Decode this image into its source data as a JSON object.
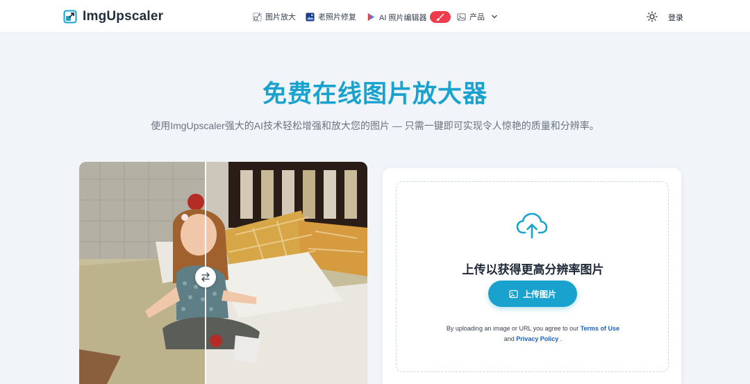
{
  "nav": {
    "brand": "ImgUpscaler",
    "items": [
      {
        "label": "图片放大",
        "icon": "upscale-icon"
      },
      {
        "label": "老照片修复",
        "icon": "photo-restore-icon"
      },
      {
        "label": "AI 照片编辑器",
        "icon": "ai-editor-icon"
      },
      {
        "label": "产品",
        "icon": "image-icon"
      }
    ],
    "login": "登录",
    "theme_icon": "sun-icon",
    "hot_badge_icon": "brush-icon"
  },
  "hero": {
    "title": "免费在线图片放大器",
    "subtitle": "使用ImgUpscaler强大的AI技术轻松增强和放大您的图片 — 只需一键即可实现令人惊艳的质量和分辨率。"
  },
  "compare": {
    "swap_icon": "swap-arrows-icon"
  },
  "upload": {
    "title": "上传以获得更高分辨率图片",
    "button": "上传图片",
    "terms_prefix": "By uploading an image or URL you agree to our",
    "terms_link": "Terms of Use",
    "and": "and",
    "privacy_link": "Privacy Policy",
    "period": "."
  },
  "colors": {
    "accent": "#1aa2cf",
    "hot_badge": "#ef3b4b",
    "link": "#1d5fbf"
  }
}
